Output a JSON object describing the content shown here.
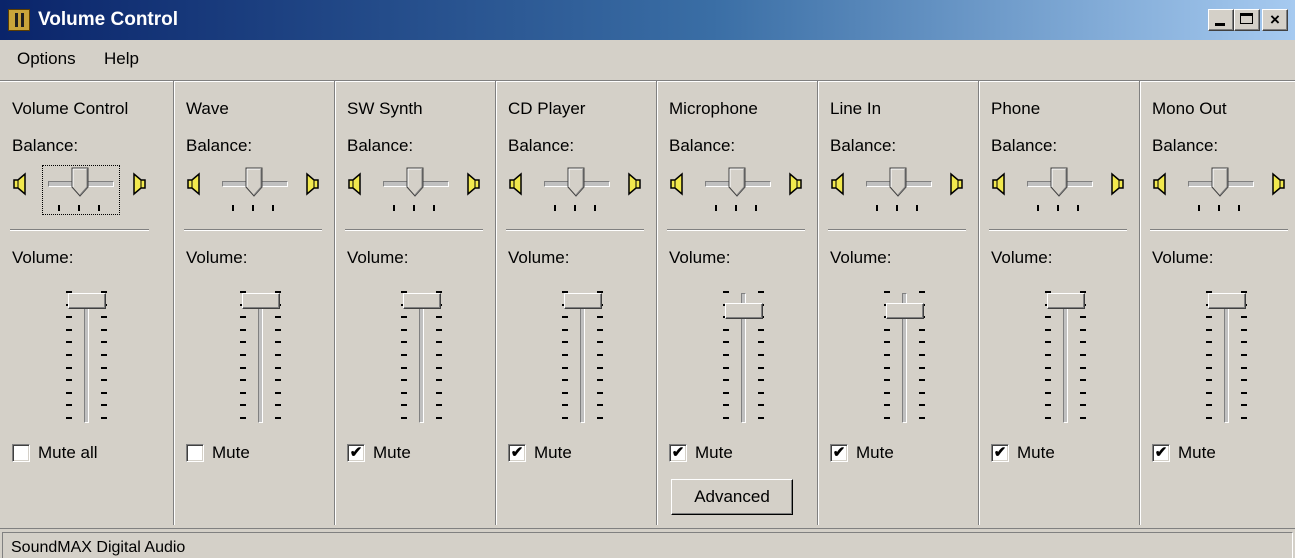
{
  "window": {
    "title": "Volume Control",
    "controls": [
      "minimize",
      "maximize",
      "close"
    ],
    "close_glyph": "×"
  },
  "menu": {
    "items": [
      {
        "label": "Options"
      },
      {
        "label": "Help"
      }
    ]
  },
  "channels": [
    {
      "name": "Volume Control",
      "balance_label": "Balance:",
      "volume_label": "Volume:",
      "volume_level": 0.93,
      "balance": 0.5,
      "mute_label": "Mute all",
      "muted": false,
      "focused": true
    },
    {
      "name": "Wave",
      "balance_label": "Balance:",
      "volume_label": "Volume:",
      "volume_level": 0.93,
      "balance": 0.5,
      "mute_label": "Mute",
      "muted": false,
      "focused": false
    },
    {
      "name": "SW Synth",
      "balance_label": "Balance:",
      "volume_label": "Volume:",
      "volume_level": 0.93,
      "balance": 0.5,
      "mute_label": "Mute",
      "muted": true,
      "focused": false
    },
    {
      "name": "CD Player",
      "balance_label": "Balance:",
      "volume_label": "Volume:",
      "volume_level": 0.93,
      "balance": 0.5,
      "mute_label": "Mute",
      "muted": true,
      "focused": false
    },
    {
      "name": "Microphone",
      "balance_label": "Balance:",
      "volume_label": "Volume:",
      "volume_level": 0.85,
      "balance": 0.5,
      "mute_label": "Mute",
      "muted": true,
      "focused": false,
      "advanced_label": "Advanced"
    },
    {
      "name": "Line In",
      "balance_label": "Balance:",
      "volume_label": "Volume:",
      "volume_level": 0.85,
      "balance": 0.5,
      "mute_label": "Mute",
      "muted": true,
      "focused": false
    },
    {
      "name": "Phone",
      "balance_label": "Balance:",
      "volume_label": "Volume:",
      "volume_level": 0.93,
      "balance": 0.5,
      "mute_label": "Mute",
      "muted": true,
      "focused": false
    },
    {
      "name": "Mono Out",
      "balance_label": "Balance:",
      "volume_label": "Volume:",
      "volume_level": 0.93,
      "balance": 0.5,
      "mute_label": "Mute",
      "muted": true,
      "focused": false
    }
  ],
  "checkmark_glyph": "✔",
  "status": {
    "text": "SoundMAX Digital Audio"
  },
  "icons": {
    "left_speaker": "speaker-left-icon",
    "right_speaker": "speaker-right-icon",
    "app": "volume-control-app-icon"
  },
  "colors": {
    "title_start": "#0a246a",
    "title_end": "#a6caf0",
    "face": "#d4d0c8",
    "speaker_fill": "#f2e94e"
  }
}
